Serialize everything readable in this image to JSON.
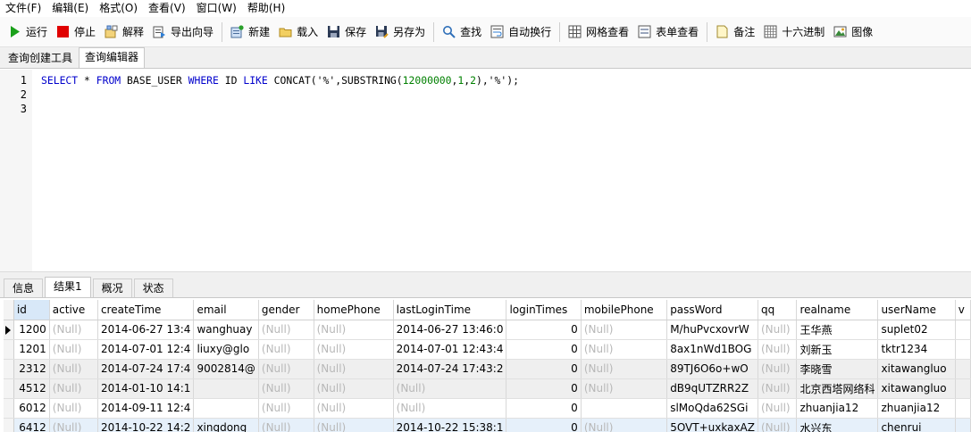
{
  "menu": [
    "文件(F)",
    "编辑(E)",
    "格式(O)",
    "查看(V)",
    "窗口(W)",
    "帮助(H)"
  ],
  "toolbar": {
    "run": "运行",
    "stop": "停止",
    "explain": "解释",
    "export_wizard": "导出向导",
    "new": "新建",
    "load": "载入",
    "save": "保存",
    "save_as": "另存为",
    "find": "查找",
    "word_wrap": "自动换行",
    "grid_view": "网格查看",
    "form_view": "表单查看",
    "memo": "备注",
    "hex": "十六进制",
    "image": "图像"
  },
  "editor_tabs": [
    "查询创建工具",
    "查询编辑器"
  ],
  "editor": {
    "line_numbers": [
      "1",
      "2",
      "3"
    ],
    "sql_parts": {
      "k1": "SELECT",
      "t1": " * ",
      "k2": "FROM",
      "t2": " BASE_USER ",
      "k3": "WHERE",
      "t3": " ID ",
      "k4": "LIKE",
      "t4": " CONCAT('%',SUBSTRING(",
      "n1": "12000000",
      "t5": ",",
      "n2": "1",
      "t6": ",",
      "n3": "2",
      "t7": "),'%');"
    }
  },
  "result_tabs": [
    "信息",
    "结果1",
    "概况",
    "状态"
  ],
  "grid": {
    "columns": [
      "id",
      "active",
      "createTime",
      "email",
      "gender",
      "homePhone",
      "lastLoginTime",
      "loginTimes",
      "mobilePhone",
      "passWord",
      "qq",
      "realname",
      "userName",
      "v"
    ],
    "rows": [
      [
        "1200",
        "(Null)",
        "2014-06-27 13:4",
        "wanghuay",
        "(Null)",
        "(Null)",
        "2014-06-27 13:46:0",
        "0",
        "(Null)",
        "M/huPvcxovrW",
        "(Null)",
        "王华燕",
        "suplet02"
      ],
      [
        "1201",
        "(Null)",
        "2014-07-01 12:4",
        "liuxy@glo",
        "(Null)",
        "(Null)",
        "2014-07-01 12:43:4",
        "0",
        "(Null)",
        "8ax1nWd1BOG",
        "(Null)",
        "刘新玉",
        "tktr1234"
      ],
      [
        "2312",
        "(Null)",
        "2014-07-24 17:4",
        "9002814@",
        "(Null)",
        "(Null)",
        "2014-07-24 17:43:2",
        "0",
        "(Null)",
        "89TJ6O6o+wO",
        "(Null)",
        "李晓雪",
        "xitawangluo"
      ],
      [
        "4512",
        "(Null)",
        "2014-01-10 14:1",
        "",
        "(Null)",
        "(Null)",
        "(Null)",
        "0",
        "(Null)",
        "dB9qUTZRR2Z",
        "(Null)",
        "北京西塔网络科",
        "xitawangluo"
      ],
      [
        "6012",
        "(Null)",
        "2014-09-11 12:4",
        "",
        "(Null)",
        "(Null)",
        "(Null)",
        "0",
        "",
        "slMoQda62SGi",
        "(Null)",
        "zhuanjia12",
        "zhuanjia12"
      ],
      [
        "6412",
        "(Null)",
        "2014-10-22 14:2",
        "xingdong",
        "(Null)",
        "(Null)",
        "2014-10-22 15:38:1",
        "0",
        "(Null)",
        "5OVT+uxkaxAZ",
        "(Null)",
        "水兴东",
        "chenrui"
      ]
    ]
  },
  "colors": {
    "keyword": "#0000cc",
    "number": "#008000",
    "null_text": "#b8b8b8",
    "run_icon": "#1aa01a",
    "stop_icon": "#e00000"
  }
}
